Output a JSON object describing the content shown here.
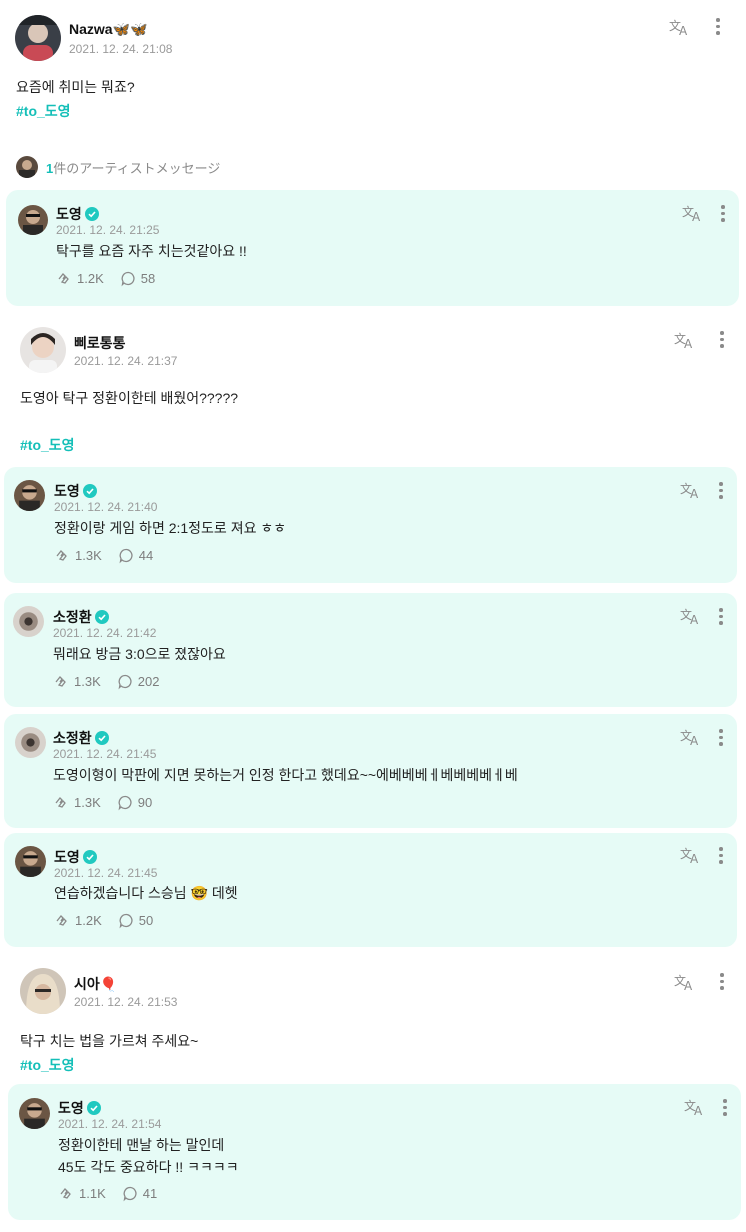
{
  "colors": {
    "accent": "#14bfb8",
    "card_bg": "#e6fbf6",
    "meta": "#9a9a9a"
  },
  "icons": {
    "translate": "translate-icon",
    "more": "kebab-icon",
    "like": "like-hands-icon",
    "comment": "comment-bubble-icon",
    "verified": "verified-check-icon"
  },
  "post1": {
    "name": "Nazwa🦋🦋",
    "time": "2021. 12. 24. 21:08",
    "text": "요즘에 취미는 뭐죠?",
    "tag": "#to_도영"
  },
  "summary": {
    "count": "1",
    "label": "件のアーティストメッセージ"
  },
  "reply1": {
    "name": "도영",
    "time": "2021. 12. 24. 21:25",
    "text": "탁구를 요즘 자주 치는것같아요 !!",
    "likes": "1.2K",
    "comments": "58"
  },
  "post2": {
    "name": "삐로통통",
    "time": "2021. 12. 24. 21:37",
    "text": "도영아 탁구 정환이한테 배웠어?????",
    "tag": "#to_도영"
  },
  "reply2": {
    "name": "도영",
    "time": "2021. 12. 24. 21:40",
    "text": "정환이랑 게임 하면 2:1정도로 져요 ㅎㅎ",
    "likes": "1.3K",
    "comments": "44"
  },
  "reply3": {
    "name": "소정환",
    "time": "2021. 12. 24. 21:42",
    "text": "뭐래요 방금 3:0으로 졌잖아요",
    "likes": "1.3K",
    "comments": "202"
  },
  "reply4": {
    "name": "소정환",
    "time": "2021. 12. 24. 21:45",
    "text": "도영이형이 막판에 지면 못하는거 인정 한다고 했데요~~에베베베ㅔ베베베베ㅔ베",
    "likes": "1.3K",
    "comments": "90"
  },
  "reply5": {
    "name": "도영",
    "time": "2021. 12. 24. 21:45",
    "text": "연습하겠습니다 스승님 🤓 데헷",
    "likes": "1.2K",
    "comments": "50"
  },
  "post3": {
    "name": "시아🎈",
    "time": "2021. 12. 24. 21:53",
    "text": "탁구 치는 법을 가르쳐 주세요~",
    "tag": "#to_도영"
  },
  "reply6": {
    "name": "도영",
    "time": "2021. 12. 24. 21:54",
    "text_line1": "정환이한테 맨날 하는 말인데",
    "text_line2": "45도 각도 중요하다 !! ㅋㅋㅋㅋ",
    "likes": "1.1K",
    "comments": "41"
  }
}
